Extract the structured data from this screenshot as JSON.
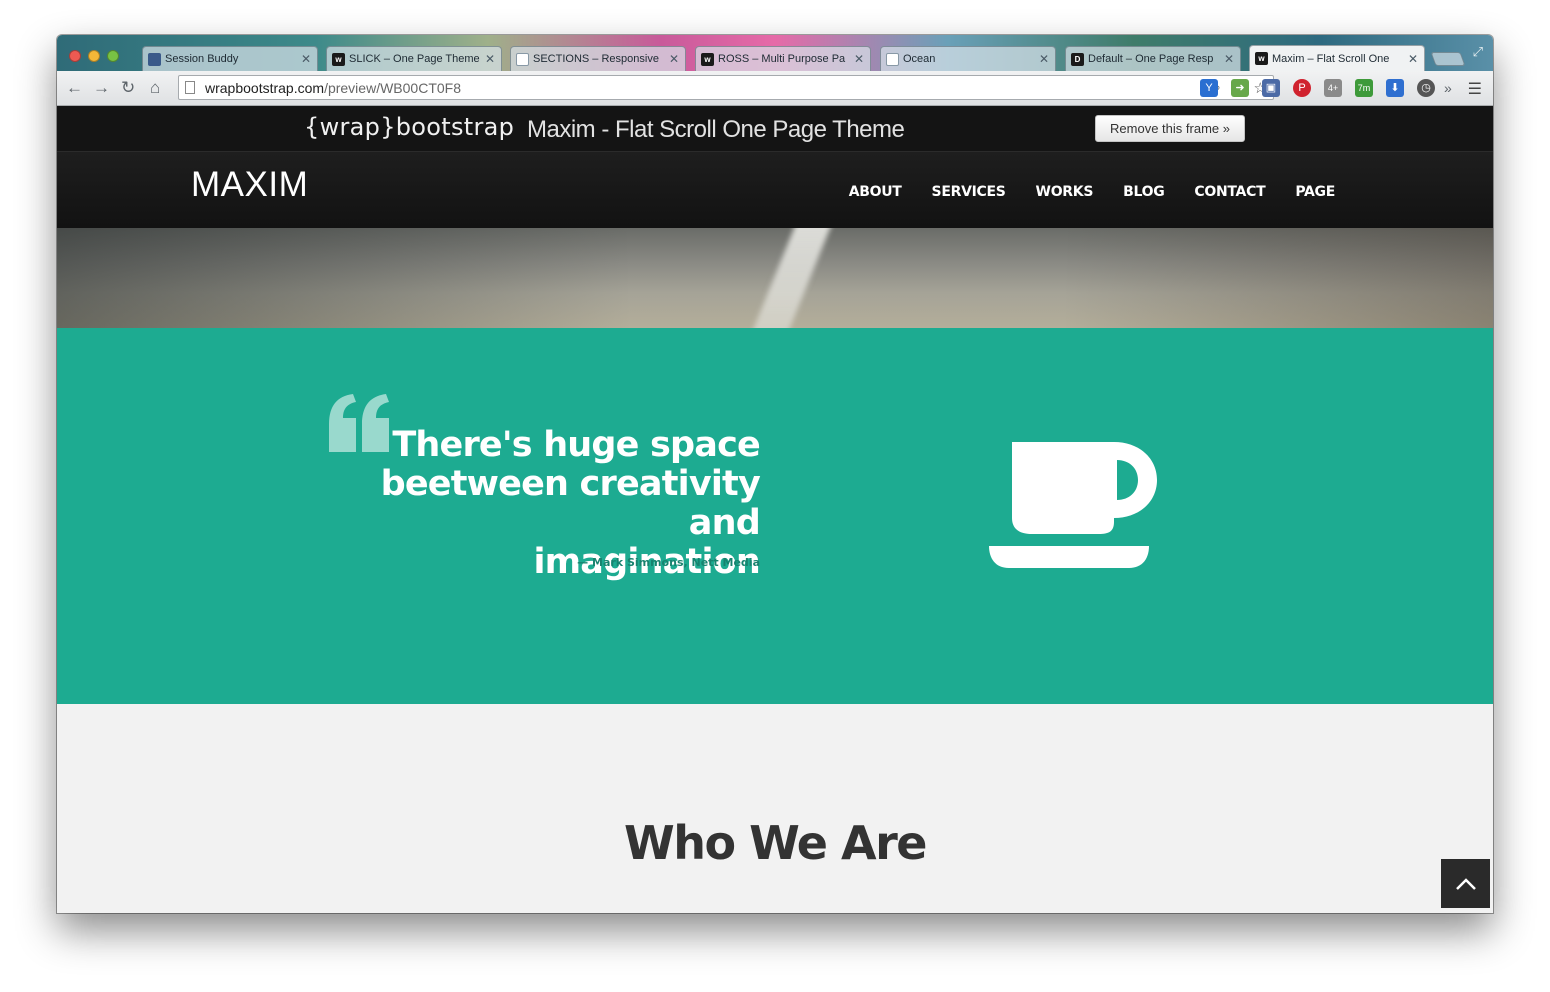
{
  "browser": {
    "tabs": [
      {
        "title": "Session Buddy",
        "favicon": "session-buddy-icon"
      },
      {
        "title": "SLICK – One Page Theme",
        "favicon": "wrapbootstrap-icon"
      },
      {
        "title": "SECTIONS – Responsive",
        "favicon": "page-icon"
      },
      {
        "title": "ROSS – Multi Purpose Pa",
        "favicon": "wrapbootstrap-icon"
      },
      {
        "title": "Ocean",
        "favicon": "page-icon"
      },
      {
        "title": "Default – One Page Resp",
        "favicon": "d-icon"
      },
      {
        "title": "Maxim – Flat Scroll One",
        "favicon": "wrapbootstrap-icon",
        "active": true
      }
    ],
    "url_host": "wrapbootstrap.com",
    "url_path": "/preview/WB00CT0F8",
    "badges": {
      "ext1": "4+",
      "ext2": "7m"
    },
    "overflow_chevron": "»"
  },
  "wb_frame": {
    "logo": "{wrap}bootstrap",
    "title": "Maxim - Flat Scroll One Page Theme",
    "remove_label": "Remove this frame »"
  },
  "site": {
    "brand": "MAXIM",
    "nav": [
      "ABOUT",
      "SERVICES",
      "WORKS",
      "BLOG",
      "CONTACT",
      "PAGE"
    ]
  },
  "quote": {
    "line1": "There's huge space",
    "line2": "beetween creativity and",
    "line3": "imagination",
    "author": "— Mark Simmons, Nett Media"
  },
  "section": {
    "title": "Who We Are"
  },
  "colors": {
    "accent_teal": "#1dab91",
    "author_text": "#18836f",
    "nav_bg": "#141414",
    "section_bg": "#f2f2f2"
  }
}
